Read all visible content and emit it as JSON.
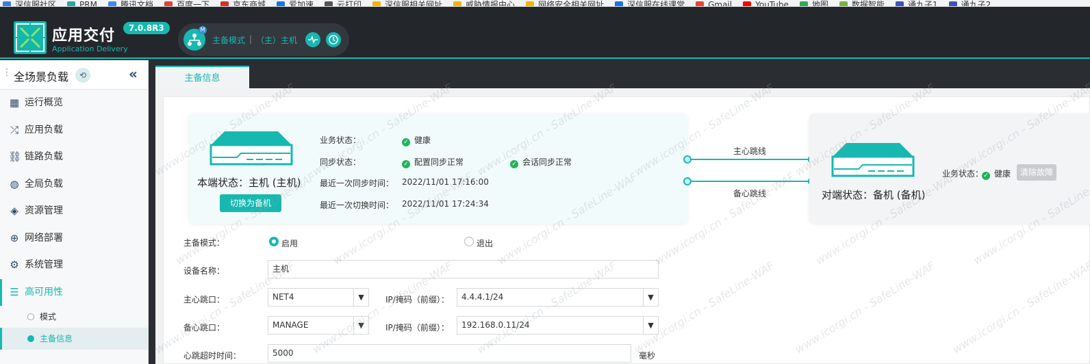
{
  "bookmarks": [
    "深信服社区",
    "PRM",
    "腾讯文档",
    "百度一下",
    "京东商城",
    "爱加速",
    "云打印",
    "深信服相关网址",
    "威胁情报中心",
    "网络安全相关网址",
    "深信服在线课堂",
    "Gmail",
    "YouTube",
    "地图",
    "数据智能",
    "通九子1",
    "通九子2"
  ],
  "app": {
    "title": "应用交付",
    "subtitle": "Application Delivery",
    "version": "7.0.8R3"
  },
  "mode": {
    "label": "主备模式",
    "role": "（主）主机",
    "net_icon": "network-topology-icon",
    "badge": "M"
  },
  "sidebar": {
    "title": "全场景负载",
    "items": [
      {
        "label": "运行概览",
        "icon": "dashboard-icon"
      },
      {
        "label": "应用负载",
        "icon": "shuffle-icon"
      },
      {
        "label": "链路负载",
        "icon": "link-icon"
      },
      {
        "label": "全局负载",
        "icon": "globe-icon"
      },
      {
        "label": "资源管理",
        "icon": "layers-icon"
      },
      {
        "label": "网络部署",
        "icon": "network-icon"
      },
      {
        "label": "系统管理",
        "icon": "gear-icon"
      },
      {
        "label": "高可用性",
        "icon": "list-icon"
      }
    ],
    "sub_items": [
      {
        "label": "模式"
      },
      {
        "label": "主备信息"
      }
    ]
  },
  "tab": {
    "label": "主备信息"
  },
  "local": {
    "status_title": "本端状态：主机 (主机)",
    "switch_button": "切换为备机",
    "biz_label": "业务状态：",
    "biz_value": "健康",
    "sync_label": "同步状态：",
    "sync_config": "配置同步正常",
    "sync_session": "会话同步正常",
    "last_sync_label": "最近一次同步时间：",
    "last_sync_value": "2022/11/01 17:16:00",
    "last_switch_label": "最近一次切换时间：",
    "last_switch_value": "2022/11/01 17:24:34"
  },
  "links": {
    "main": "主心跳线",
    "backup": "备心跳线"
  },
  "peer": {
    "status_title": "对端状态：备机 (备机)",
    "biz_label": "业务状态：",
    "biz_value": "健康",
    "clear_button": "清除故障"
  },
  "form": {
    "mode_label": "主备模式：",
    "mode_on": "启用",
    "mode_off": "退出",
    "device_name_label": "设备名称：",
    "device_name_value": "主机",
    "main_hb_label": "主心跳口：",
    "main_hb_port": "NET4",
    "ip_label": "IP/掩码（前缀）：",
    "main_hb_ip": "4.4.4.1/24",
    "backup_hb_label": "备心跳口：",
    "backup_hb_port": "MANAGE",
    "backup_hb_ip": "192.168.0.11/24",
    "timeout_label": "心跳超时时间：",
    "timeout_value": "5000",
    "timeout_unit": "毫秒"
  },
  "watermark": "www.icorgi.cn - SafeLine-WAF",
  "colors": {
    "accent": "#17b8b0",
    "ok": "#20b45a",
    "dark": "#23272c"
  }
}
